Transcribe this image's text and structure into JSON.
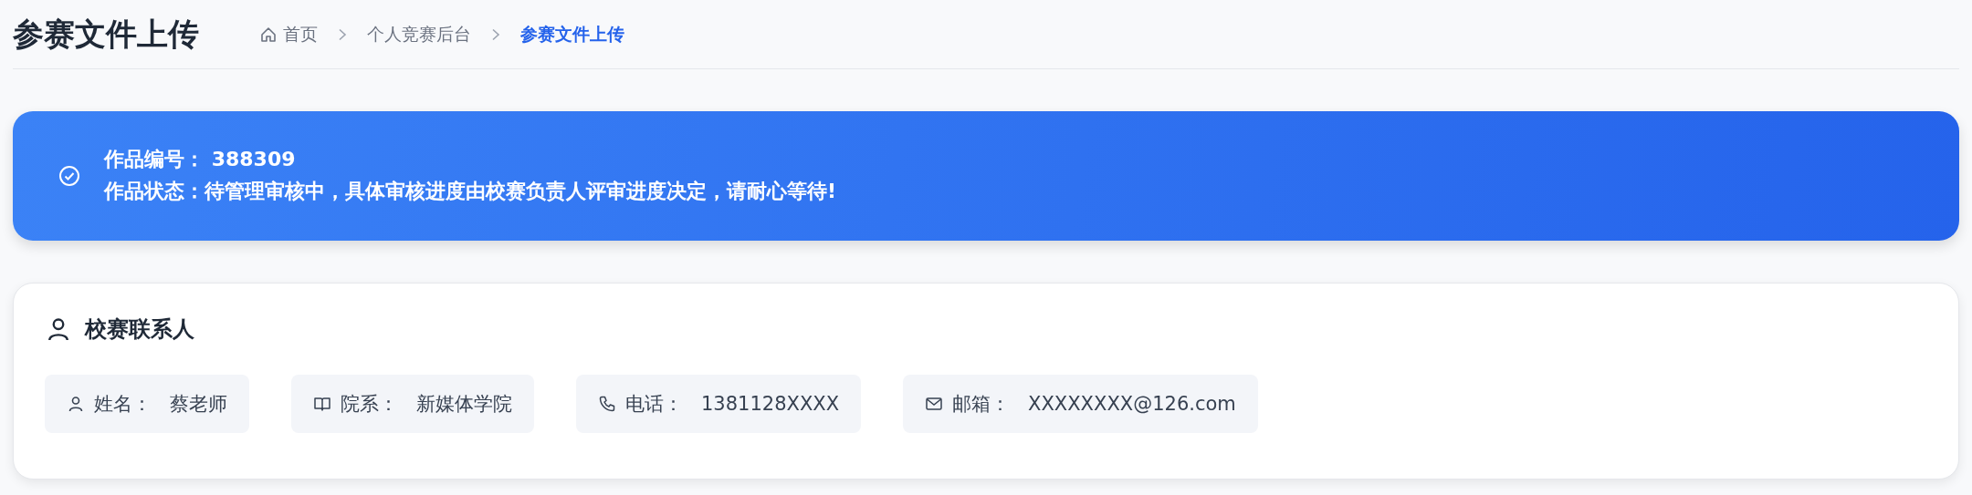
{
  "page_title": "参赛文件上传",
  "breadcrumb": [
    {
      "label": "首页",
      "kind": "home",
      "selected": false
    },
    {
      "label": "个人竞赛后台",
      "kind": "link",
      "selected": false
    },
    {
      "label": "参赛文件上传",
      "kind": "link",
      "selected": true
    }
  ],
  "status_banner": {
    "lines": [
      "作品编号： 388309",
      "作品状态：待管理审核中，具体审核进度由校赛负责人评审进度决定，请耐心等待!"
    ]
  },
  "contact_card": {
    "title": "校赛联系人",
    "items": [
      {
        "kind": "name",
        "label": "姓名：",
        "value": "蔡老师"
      },
      {
        "kind": "department",
        "label": "院系：",
        "value": "新媒体学院"
      },
      {
        "kind": "phone",
        "label": "电话：",
        "value": "1381128XXXX"
      },
      {
        "kind": "email",
        "label": "邮箱：",
        "value": "XXXXXXXX@126.com"
      }
    ]
  }
}
